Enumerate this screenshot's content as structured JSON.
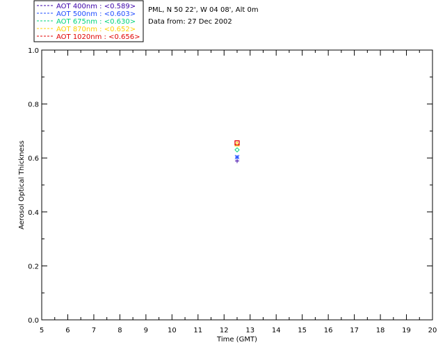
{
  "chart_data": {
    "type": "scatter",
    "info_lines": [
      "PML, N 50 22', W 04 08', Alt 0m",
      "Data from: 27 Dec 2002"
    ],
    "xlabel": "Time (GMT)",
    "ylabel": "Aerosol Optical Thickness",
    "xlim": [
      5,
      20
    ],
    "ylim": [
      0,
      1
    ],
    "x_ticks": [
      "5",
      "6",
      "7",
      "8",
      "9",
      "10",
      "11",
      "12",
      "13",
      "14",
      "15",
      "16",
      "17",
      "18",
      "19",
      "20"
    ],
    "y_ticks": [
      "0.0",
      "0.2",
      "0.4",
      "0.6",
      "0.8",
      "1.0"
    ],
    "grid": false,
    "legend_position": "top-left (outside plot)",
    "series": [
      {
        "name": "AOT  400nm : <0.589>",
        "color": "#3a00a8",
        "marker": "plus",
        "points": [
          [
            12.5,
            0.589
          ]
        ]
      },
      {
        "name": "AOT  500nm : <0.603>",
        "color": "#1e4bff",
        "marker": "asterisk",
        "points": [
          [
            12.5,
            0.603
          ]
        ]
      },
      {
        "name": "AOT  675nm : <0.630>",
        "color": "#00d47a",
        "marker": "diamond",
        "points": [
          [
            12.5,
            0.63
          ]
        ]
      },
      {
        "name": "AOT  870nm : <0.652>",
        "color": "#ffd000",
        "marker": "triangle",
        "points": [
          [
            12.5,
            0.652
          ]
        ]
      },
      {
        "name": "AOT 1020nm : <0.656>",
        "color": "#e00000",
        "marker": "square",
        "points": [
          [
            12.5,
            0.656
          ]
        ]
      }
    ]
  }
}
